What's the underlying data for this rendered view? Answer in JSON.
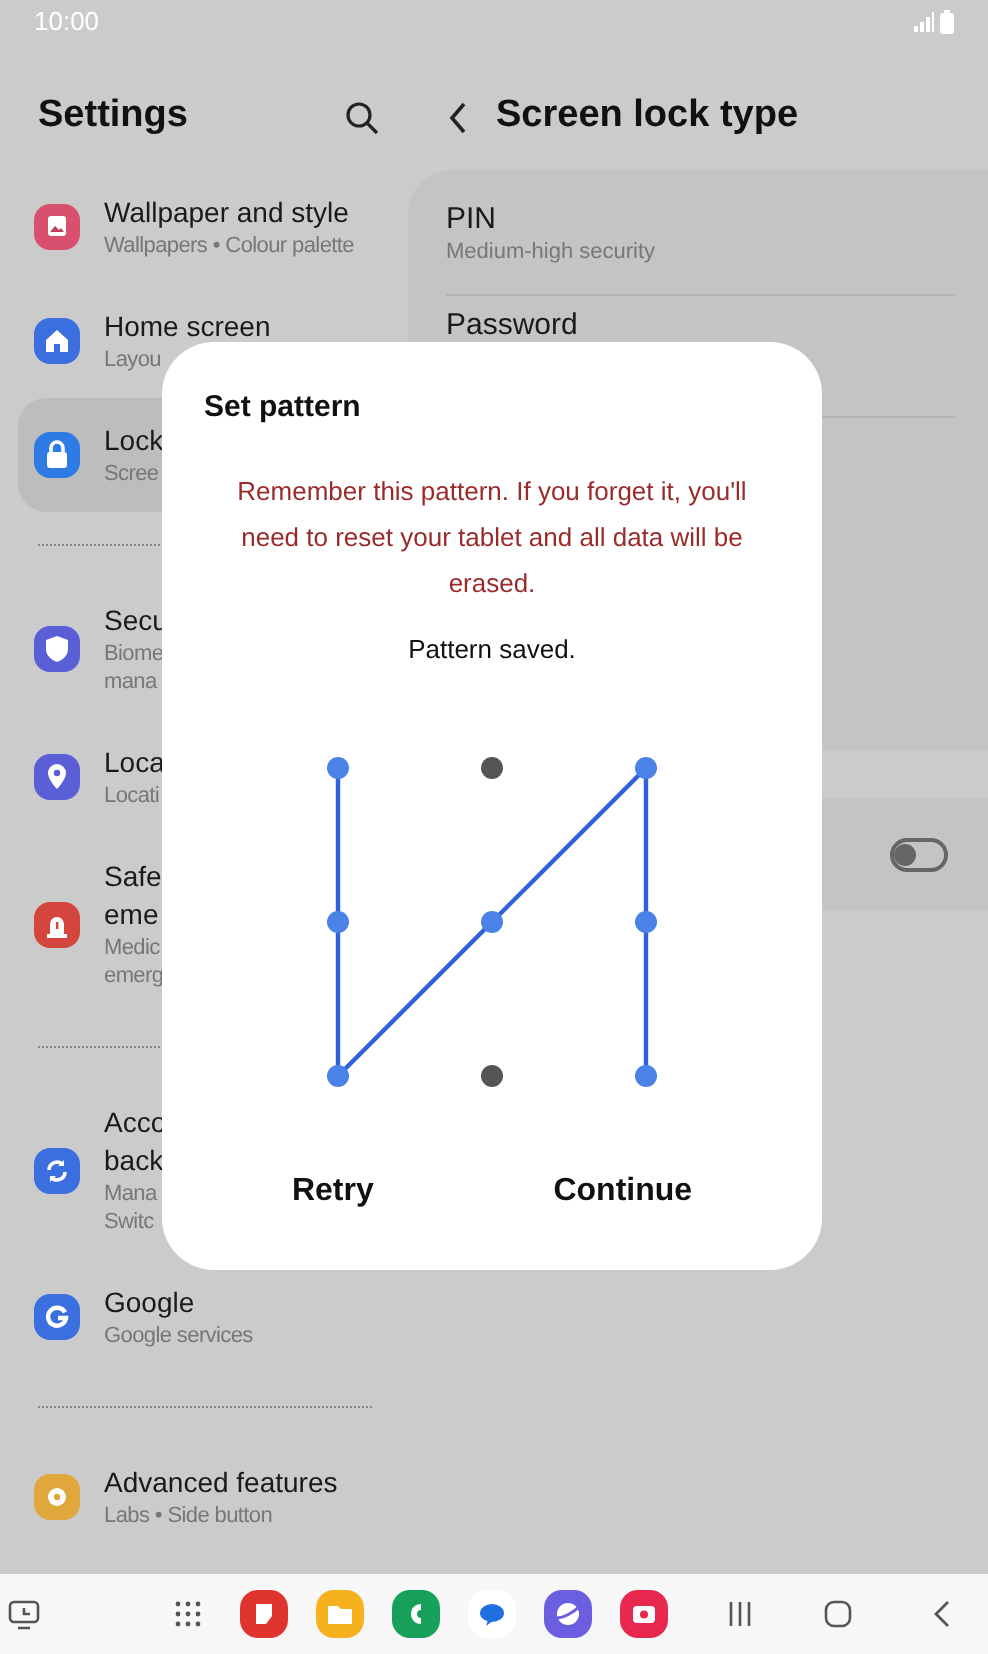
{
  "status_bar": {
    "time": "10:00"
  },
  "settings": {
    "title": "Settings",
    "items": [
      {
        "kind": "item",
        "title_lines": [
          "Wallpaper and style"
        ],
        "subtitle_lines": [
          "Wallpapers • Colour palette"
        ],
        "color": "#d9506f",
        "selected": false
      },
      {
        "kind": "item",
        "title_lines": [
          "Home screen"
        ],
        "subtitle_lines": [
          "Layou"
        ],
        "color": "#3b6fe0",
        "selected": false
      },
      {
        "kind": "item",
        "title_lines": [
          "Lock"
        ],
        "subtitle_lines": [
          "Scree"
        ],
        "color": "#2f7be6",
        "selected": true
      },
      {
        "kind": "divider"
      },
      {
        "kind": "item",
        "title_lines": [
          "Secu"
        ],
        "subtitle_lines": [
          "Biome",
          "mana"
        ],
        "color": "#5a5fd8",
        "selected": false
      },
      {
        "kind": "item",
        "title_lines": [
          "Loca"
        ],
        "subtitle_lines": [
          "Locati"
        ],
        "color": "#5a5fd8",
        "selected": false
      },
      {
        "kind": "item",
        "title_lines": [
          "Safe",
          "eme"
        ],
        "subtitle_lines": [
          "Medic",
          "emerg"
        ],
        "color": "#d4463d",
        "selected": false
      },
      {
        "kind": "divider"
      },
      {
        "kind": "item",
        "title_lines": [
          "Acco",
          "back"
        ],
        "subtitle_lines": [
          "Mana",
          "Switc"
        ],
        "color": "#3b6fe0",
        "selected": false
      },
      {
        "kind": "item",
        "title_lines": [
          "Google"
        ],
        "subtitle_lines": [
          "Google services"
        ],
        "color": "#3b6fe0",
        "selected": false
      },
      {
        "kind": "divider"
      },
      {
        "kind": "item",
        "title_lines": [
          "Advanced features"
        ],
        "subtitle_lines": [
          "Labs • Side button"
        ],
        "color": "#e0a73c",
        "selected": false
      }
    ]
  },
  "screen_lock": {
    "title": "Screen lock type",
    "options": [
      {
        "title": "PIN",
        "subtitle": "Medium-high security"
      },
      {
        "title": "Password"
      }
    ],
    "toggle": {
      "on": false
    }
  },
  "dialog": {
    "title": "Set pattern",
    "warning": "Remember this pattern. If you forget it, you'll need to reset your tablet and all data will be erased.",
    "status": "Pattern saved.",
    "dots": [
      {
        "selected": true
      },
      {
        "selected": false
      },
      {
        "selected": true
      },
      {
        "selected": true
      },
      {
        "selected": true
      },
      {
        "selected": true
      },
      {
        "selected": true
      },
      {
        "selected": false
      },
      {
        "selected": true
      }
    ],
    "buttons": [
      "Retry",
      "Continue"
    ]
  }
}
